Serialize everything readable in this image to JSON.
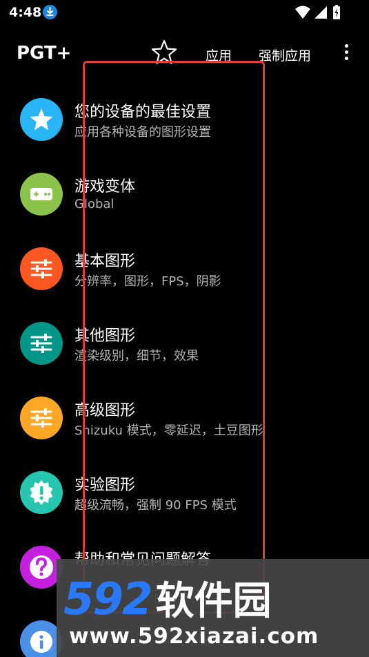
{
  "status_bar": {
    "time": "4:48"
  },
  "app_bar": {
    "title": "PGT+",
    "apply_label": "应用",
    "force_apply_label": "强制应用"
  },
  "menu": [
    {
      "icon": "star-icon",
      "color": "#29b6f6",
      "title": "您的设备的最佳设置",
      "subtitle": "应用各种设备的图形设置"
    },
    {
      "icon": "gamepad-icon",
      "color": "#8bc34a",
      "title": "游戏变体",
      "subtitle": "Global"
    },
    {
      "icon": "sliders-icon",
      "color": "#ff5722",
      "title": "基本图形",
      "subtitle": "分辨率，图形，FPS，阴影"
    },
    {
      "icon": "sliders-icon",
      "color": "#009688",
      "title": "其他图形",
      "subtitle": "渲染级别，细节，效果"
    },
    {
      "icon": "sliders-icon",
      "color": "#ffa726",
      "title": "高级图形",
      "subtitle": "Shizuku 模式，零延迟，土豆图形"
    },
    {
      "icon": "alert-badge-icon",
      "color": "#26c6b0",
      "title": "实验图形",
      "subtitle": "超级流畅，强制 90 FPS 模式"
    },
    {
      "icon": "help-icon",
      "color": "#c51fe0",
      "title": "帮助和常见问题解答",
      "subtitle": ""
    },
    {
      "icon": "info-icon",
      "color": "#4a8fe8",
      "title": "",
      "subtitle": ""
    }
  ],
  "watermark": {
    "number": "592",
    "brand": "软件园",
    "url": "www.592xiazai.com"
  },
  "colors": {
    "highlight": "#e53935",
    "background": "#000000"
  }
}
